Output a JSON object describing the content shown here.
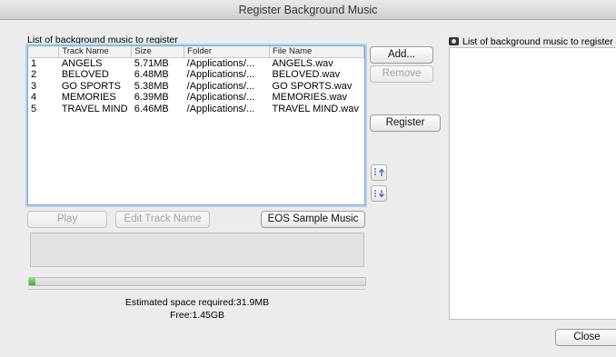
{
  "window": {
    "title": "Register Background Music"
  },
  "left_list": {
    "title": "List of background music to register",
    "columns": [
      "",
      "Track Name",
      "Size",
      "Folder",
      "File Name"
    ],
    "rows": [
      [
        "1",
        "ANGELS",
        "5.71MB",
        "/Applications/...",
        "ANGELS.wav"
      ],
      [
        "2",
        "BELOVED",
        "6.48MB",
        "/Applications/...",
        "BELOVED.wav"
      ],
      [
        "3",
        "GO SPORTS",
        "5.38MB",
        "/Applications/...",
        "GO SPORTS.wav"
      ],
      [
        "4",
        "MEMORIES",
        "6.39MB",
        "/Applications/...",
        "MEMORIES.wav"
      ],
      [
        "5",
        "TRAVEL MIND",
        "6.46MB",
        "/Applications/...",
        "TRAVEL MIND.wav"
      ]
    ]
  },
  "buttons": {
    "add": "Add...",
    "remove": "Remove",
    "register": "Register",
    "play": "Play",
    "edit_track_name": "Edit Track Name",
    "eos_sample_music": "EOS Sample Music",
    "close": "Close"
  },
  "icons": {
    "move_up": "move-up-icon",
    "move_down": "move-down-icon",
    "camera": "camera-icon"
  },
  "progress": {
    "fraction": 0.02,
    "color": "#3fae2a"
  },
  "space": {
    "estimated": "Estimated space required:31.9MB",
    "free": "Free:1.45GB"
  },
  "right_list": {
    "title_line1": "List of background music to register on",
    "title_line2": "camera"
  }
}
